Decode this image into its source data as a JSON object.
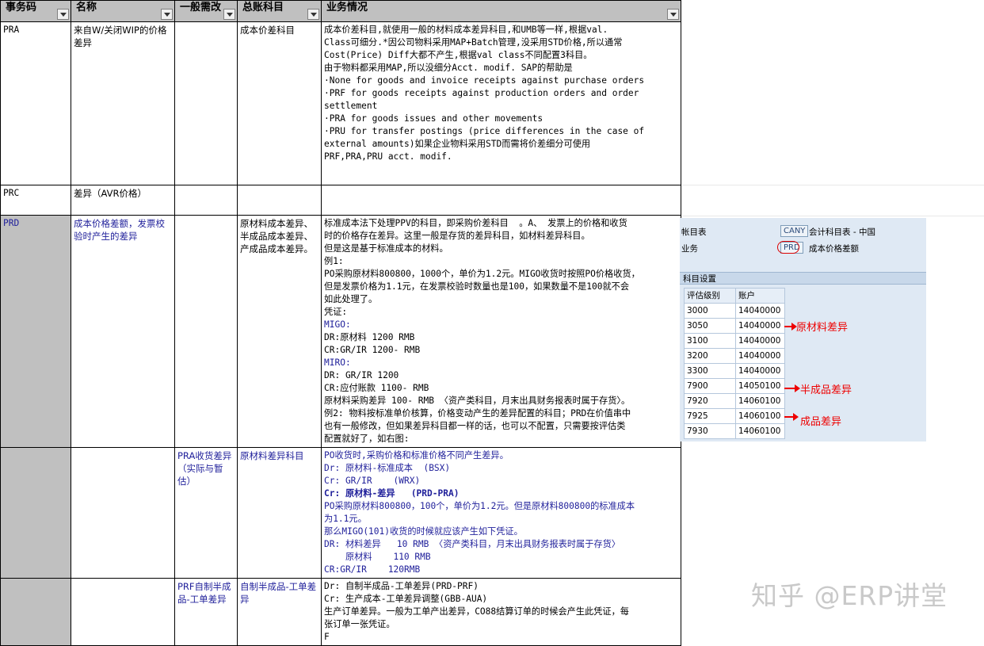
{
  "headers": [
    "事务码",
    "名称",
    "一般需改",
    "总账科目",
    "业务情况"
  ],
  "rows": [
    {
      "code": "PRA",
      "name": "来自W/关闭WIP的价格差异",
      "change": "",
      "account": "成本价差科目",
      "lines": [
        "成本价差科目,就使用一般的材料成本差异科目,和UMB等一样,根据val.",
        "Class可细分.*因公司物料采用MAP+Batch管理,没采用STD价格,所以通常",
        "Cost(Price) Diff大都不产生,根据val class不同配置3科目。",
        "由于物料都采用MAP,所以没细分Acct. modif. SAP的帮助是",
        "·None for goods and invoice receipts against purchase orders",
        "·PRF for goods receipts against production orders and order",
        "settlement",
        "·PRA for goods issues and other movements",
        "·PRU for transfer postings (price differences in the case of",
        "external amounts)如果企业物料采用STD而需将价差细分可使用",
        "PRF,PRA,PRU acct. modif."
      ]
    },
    {
      "code": "PRC",
      "name": "差异（AVR价格）",
      "change": "",
      "account": "",
      "lines": []
    },
    {
      "code": "PRD",
      "name": "成本价格差额，发票校验时产生的差异",
      "change": "",
      "account": "原材料成本差异、半成品成本差异、产成品成本差异。",
      "lines": [
        "标准成本法下处理PPV的科目，即采购价差科目  。A、 发票上的价格和收货",
        "时的价格存在差异。这里一般是存货的差异科目，如材料差异科目。",
        "但是这是基于标准成本的材料。",
        "例1:",
        "PO采购原材料800800，1000个，单价为1.2元。MIGO收货时按照PO价格收货，",
        "但是发票价格为1.1元，在发票校验时数量也是100，如果数量不是100就不会",
        "如此处理了。",
        "凭证:",
        "MIGO:",
        "DR:原材料 1200 RMB",
        "CR:GR/IR 1200- RMB",
        "MIRO:",
        "DR: GR/IR 1200",
        "CR:应付账款 1100- RMB",
        "原材料采购差异 100- RMB 〈资产类科目，月末出具财务报表时属于存货〉。",
        "例2: 物料按标准单价核算，价格变动产生的差异配置的科目；PRD在价值串中",
        "也有一般修改，但如果差异科目都一样的话，也可以不配置，只需要按评估类",
        "配置就好了，如右图:"
      ]
    },
    {
      "code": "",
      "name": "",
      "change": "PRA收货差异（实际与暂估）",
      "account": "原材料差异科目",
      "lines": [
        "PO收货时,采购价格和标准价格不同产生差异。",
        "Dr: 原材料-标准成本  (BSX)",
        "Cr: GR/IR    (WRX)",
        "Cr: 原材料-差异   (PRD-PRA)",
        "PO采购原材料800800，100个，单价为1.2元。但是原材料800800的标准成本",
        "为1.1元。",
        "那么MIGO(101)收货的时候就应该产生如下凭证。",
        "DR: 材料差异   10 RMB 〈资产类科目，月末出具财务报表时属于存货〉",
        "    原材料    110 RMB",
        "CR:GR/IR    120RMB"
      ]
    },
    {
      "code": "",
      "name": "",
      "change": "PRF自制半成品-工单差异",
      "account": "自制半成品-工单差异",
      "lines": [
        "Dr: 自制半成品-工单差异(PRD-PRF)",
        "Cr: 生产成本-工单差异调整(GBB-AUA)",
        "生产订单差异。一般为工单产出差异，CO88结算订单的时候会产生此凭证，每",
        "张订单一张凭证。",
        "F"
      ]
    }
  ],
  "panel": {
    "label_chart": "帐目表",
    "chart_value": "CANY",
    "chart_desc": "会计科目表 - 中国",
    "label_txn": "业务",
    "txn_value": "PRD",
    "txn_desc": "成本价格差额",
    "section": "科目设置",
    "grid_headers": [
      "评估级别",
      "账户"
    ],
    "grid_rows": [
      [
        "3000",
        "14040000"
      ],
      [
        "3050",
        "14040000"
      ],
      [
        "3100",
        "14040000"
      ],
      [
        "3200",
        "14040000"
      ],
      [
        "3300",
        "14040000"
      ],
      [
        "7900",
        "14050100"
      ],
      [
        "7920",
        "14060100"
      ],
      [
        "7925",
        "14060100"
      ],
      [
        "7930",
        "14060100"
      ]
    ],
    "annotations": [
      "原材料差异",
      "半成品差异",
      "成品差异"
    ]
  },
  "watermark": "知乎 @ERP讲堂",
  "colors": {
    "header_bg": "#c0c0c0",
    "blue_text": "#1f1f9a",
    "annotation_red": "#e00000",
    "panel_bg": "#dfe9f4"
  }
}
